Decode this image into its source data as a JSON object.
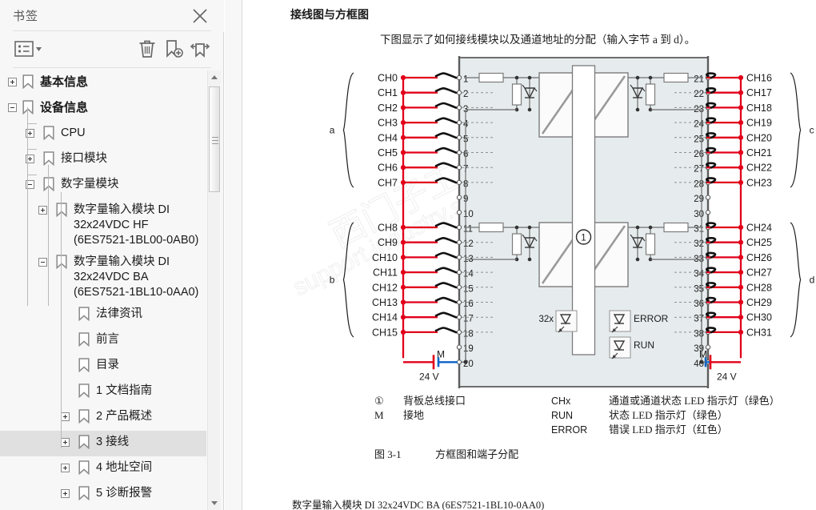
{
  "sidebar": {
    "title": "书签",
    "close_icon": "close-icon",
    "toolbar": {
      "list_options_label": "list-options",
      "delete_label": "delete-bookmark",
      "add_label": "add-bookmark",
      "expand_label": "expand-bookmarks"
    },
    "tree": [
      {
        "id": "basic-info",
        "label": "基本信息",
        "depth": 0,
        "toggle": "plus",
        "bold": true
      },
      {
        "id": "device-info",
        "label": "设备信息",
        "depth": 0,
        "toggle": "minus",
        "bold": true
      },
      {
        "id": "cpu",
        "label": "CPU",
        "depth": 1,
        "toggle": "plus",
        "bold": false
      },
      {
        "id": "interface-module",
        "label": "接口模块",
        "depth": 1,
        "toggle": "plus",
        "bold": false
      },
      {
        "id": "digital-module",
        "label": "数字量模块",
        "depth": 1,
        "toggle": "minus",
        "bold": false
      },
      {
        "id": "di-hf",
        "label": "数字量输入模块 DI 32x24VDC HF (6ES7521-1BL00-0AB0)",
        "depth": 2,
        "toggle": "plus",
        "bold": false
      },
      {
        "id": "di-ba",
        "label": "数字量输入模块 DI 32x24VDC BA (6ES7521-1BL10-0AA0)",
        "depth": 2,
        "toggle": "minus",
        "bold": false
      },
      {
        "id": "legal",
        "label": "法律资讯",
        "depth": 3,
        "toggle": "none",
        "bold": false
      },
      {
        "id": "preface",
        "label": "前言",
        "depth": 3,
        "toggle": "none",
        "bold": false
      },
      {
        "id": "toc",
        "label": "目录",
        "depth": 3,
        "toggle": "none",
        "bold": false
      },
      {
        "id": "doc-guide",
        "label": "1 文档指南",
        "depth": 3,
        "toggle": "none",
        "bold": false
      },
      {
        "id": "product-overview",
        "label": "2 产品概述",
        "depth": 3,
        "toggle": "plus",
        "bold": false
      },
      {
        "id": "wiring",
        "label": "3 接线",
        "depth": 3,
        "toggle": "plus",
        "bold": false,
        "selected": true
      },
      {
        "id": "address-space",
        "label": "4 地址空间",
        "depth": 3,
        "toggle": "plus",
        "bold": false
      },
      {
        "id": "diagnostics",
        "label": "5 诊断报警",
        "depth": 3,
        "toggle": "plus",
        "bold": false
      }
    ],
    "scrollbar": {
      "up_icon": "scroll-up-icon",
      "down_icon": "scroll-down-icon"
    },
    "pane_collapse_icon": "collapse-pane-icon"
  },
  "content": {
    "heading": "接线图与方框图",
    "intro": "下图显示了如何接线模块以及通道地址的分配（输入字节 a 到 d）。",
    "figure_caption_num": "图 3-1",
    "figure_caption_text": "方框图和端子分配",
    "footer": "数字量输入模块 DI 32x24VDC BA (6ES7521-1BL10-0AA0)",
    "watermark": "西门子工业支持中心 support.industry.siemens.com.cn",
    "legend": [
      {
        "sym": "①",
        "txt": "背板总线接口",
        "sym2": "CHx",
        "txt2": "通道或通道状态 LED 指示灯（绿色）"
      },
      {
        "sym": "M",
        "txt": "接地",
        "sym2": "RUN",
        "txt2": "状态 LED 指示灯（绿色）"
      },
      {
        "sym": "",
        "txt": "",
        "sym2": "ERROR",
        "txt2": "错误 LED 指示灯（红色）"
      }
    ]
  },
  "figure": {
    "module_label": "DI 32x24VDC BA",
    "backplane_marker": "①",
    "left_groups": [
      {
        "name": "a",
        "channels": [
          "CH0",
          "CH1",
          "CH2",
          "CH3",
          "CH4",
          "CH5",
          "CH6",
          "CH7"
        ]
      },
      {
        "name": "b",
        "channels": [
          "CH8",
          "CH9",
          "CH10",
          "CH11",
          "CH12",
          "CH13",
          "CH14",
          "CH15"
        ]
      }
    ],
    "right_groups": [
      {
        "name": "c",
        "channels": [
          "CH16",
          "CH17",
          "CH18",
          "CH19",
          "CH20",
          "CH21",
          "CH22",
          "CH23"
        ]
      },
      {
        "name": "d",
        "channels": [
          "CH24",
          "CH25",
          "CH26",
          "CH27",
          "CH28",
          "CH29",
          "CH30",
          "CH31"
        ]
      }
    ],
    "left_terminals": [
      "1",
      "2",
      "3",
      "4",
      "5",
      "6",
      "7",
      "8",
      "9",
      "10",
      "11",
      "12",
      "13",
      "14",
      "15",
      "16",
      "17",
      "18",
      "19",
      "20"
    ],
    "right_terminals": [
      "21",
      "22",
      "23",
      "24",
      "25",
      "26",
      "27",
      "28",
      "29",
      "30",
      "31",
      "32",
      "33",
      "34",
      "35",
      "36",
      "37",
      "38",
      "39",
      "40"
    ],
    "supply_left": {
      "ground": "M",
      "voltage": "24 V"
    },
    "supply_right": {
      "ground": "M",
      "voltage": "24 V"
    },
    "led_channel_count": "32x",
    "led_error": "ERROR",
    "led_run": "RUN"
  },
  "colors": {
    "wire_red": "#e2001a",
    "wire_blue": "#0b63c5",
    "module_fill": "#e6ecee",
    "module_border": "#6e6e6e",
    "line_gray": "#707070",
    "selection": "#e0e0e0"
  }
}
